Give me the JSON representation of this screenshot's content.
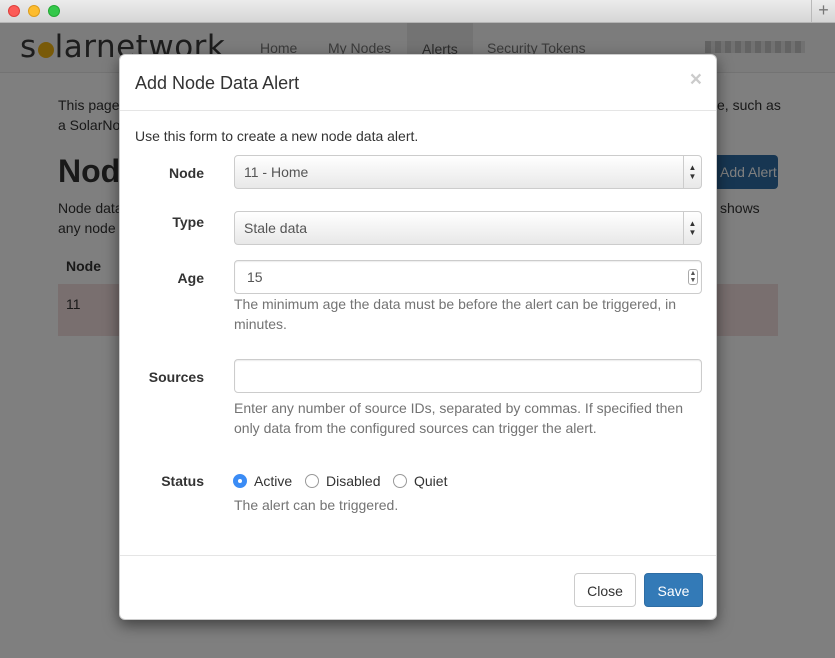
{
  "window": {
    "new_tab_label": "+"
  },
  "navbar": {
    "logo_prefix": "s",
    "logo_suffix": "larnetwork",
    "items": [
      {
        "label": "Home"
      },
      {
        "label": "My Nodes"
      },
      {
        "label": "Alerts"
      },
      {
        "label": "Security Tokens"
      }
    ]
  },
  "page": {
    "intro_line1_start": "This page",
    "intro_line1_end": "e, such as",
    "intro_line2": "a SolarNo",
    "heading": "Node",
    "add_alert_label": "Add Alert",
    "desc_line1_start": "Node data",
    "desc_line1_end": "shows",
    "desc_line2": "any node",
    "table_header": "Node",
    "table_row_node": "11"
  },
  "modal": {
    "title": "Add Node Data Alert",
    "close_glyph": "×",
    "intro": "Use this form to create a new node data alert.",
    "node_label": "Node",
    "node_value": "11 - Home",
    "type_label": "Type",
    "type_value": "Stale data",
    "age_label": "Age",
    "age_value": "15",
    "age_help": "The minimum age the data must be before the alert can be triggered, in minutes.",
    "sources_label": "Sources",
    "sources_value": "",
    "sources_help": "Enter any number of source IDs, separated by commas. If specified then only data from the configured sources can trigger the alert.",
    "status_label": "Status",
    "status_options": [
      {
        "label": "Active",
        "selected": true
      },
      {
        "label": "Disabled",
        "selected": false
      },
      {
        "label": "Quiet",
        "selected": false
      }
    ],
    "status_help": "The alert can be triggered.",
    "close_button": "Close",
    "save_button": "Save"
  },
  "colors": {
    "primary": "#337ab7",
    "radio_selected": "#3b8cf5",
    "logo_sun": "#f2b410",
    "danger_row": "#f2dede"
  }
}
